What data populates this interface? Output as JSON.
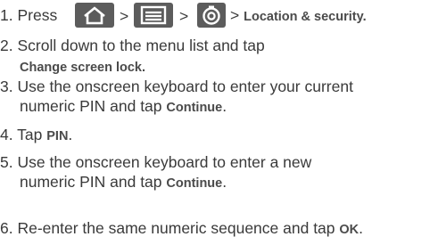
{
  "colors": {
    "text": "#3a3a3a",
    "emphasis": "#4a4a4a",
    "icon_bg": "#5c5c5c",
    "icon_fg": "#ffffff"
  },
  "icons": [
    "home-icon",
    "menu-icon",
    "settings-icon"
  ],
  "steps": [
    {
      "number": "1.",
      "text_press": "Press",
      "sep1": ">",
      "sep2": ">",
      "sep3": ">",
      "bold": "Location & security",
      "end": "."
    },
    {
      "number": "2.",
      "line1": "Scroll down to the menu list and tap",
      "bold": "Change screen lock",
      "end": "."
    },
    {
      "number": "3.",
      "line1": "Use the onscreen keyboard to enter your current",
      "line2_pre": "numeric PIN and tap",
      "bold": "Continue",
      "end": "."
    },
    {
      "number": "4.",
      "text_pre": "Tap",
      "bold": "PIN",
      "end": "."
    },
    {
      "number": "5.",
      "line1": "Use the onscreen keyboard to enter a new",
      "line2_pre": "numeric PIN and tap",
      "bold": "Continue",
      "end": "."
    },
    {
      "number": "6.",
      "text_pre": "Re-enter the same numeric sequence and tap",
      "bold": "OK",
      "end": "."
    }
  ]
}
